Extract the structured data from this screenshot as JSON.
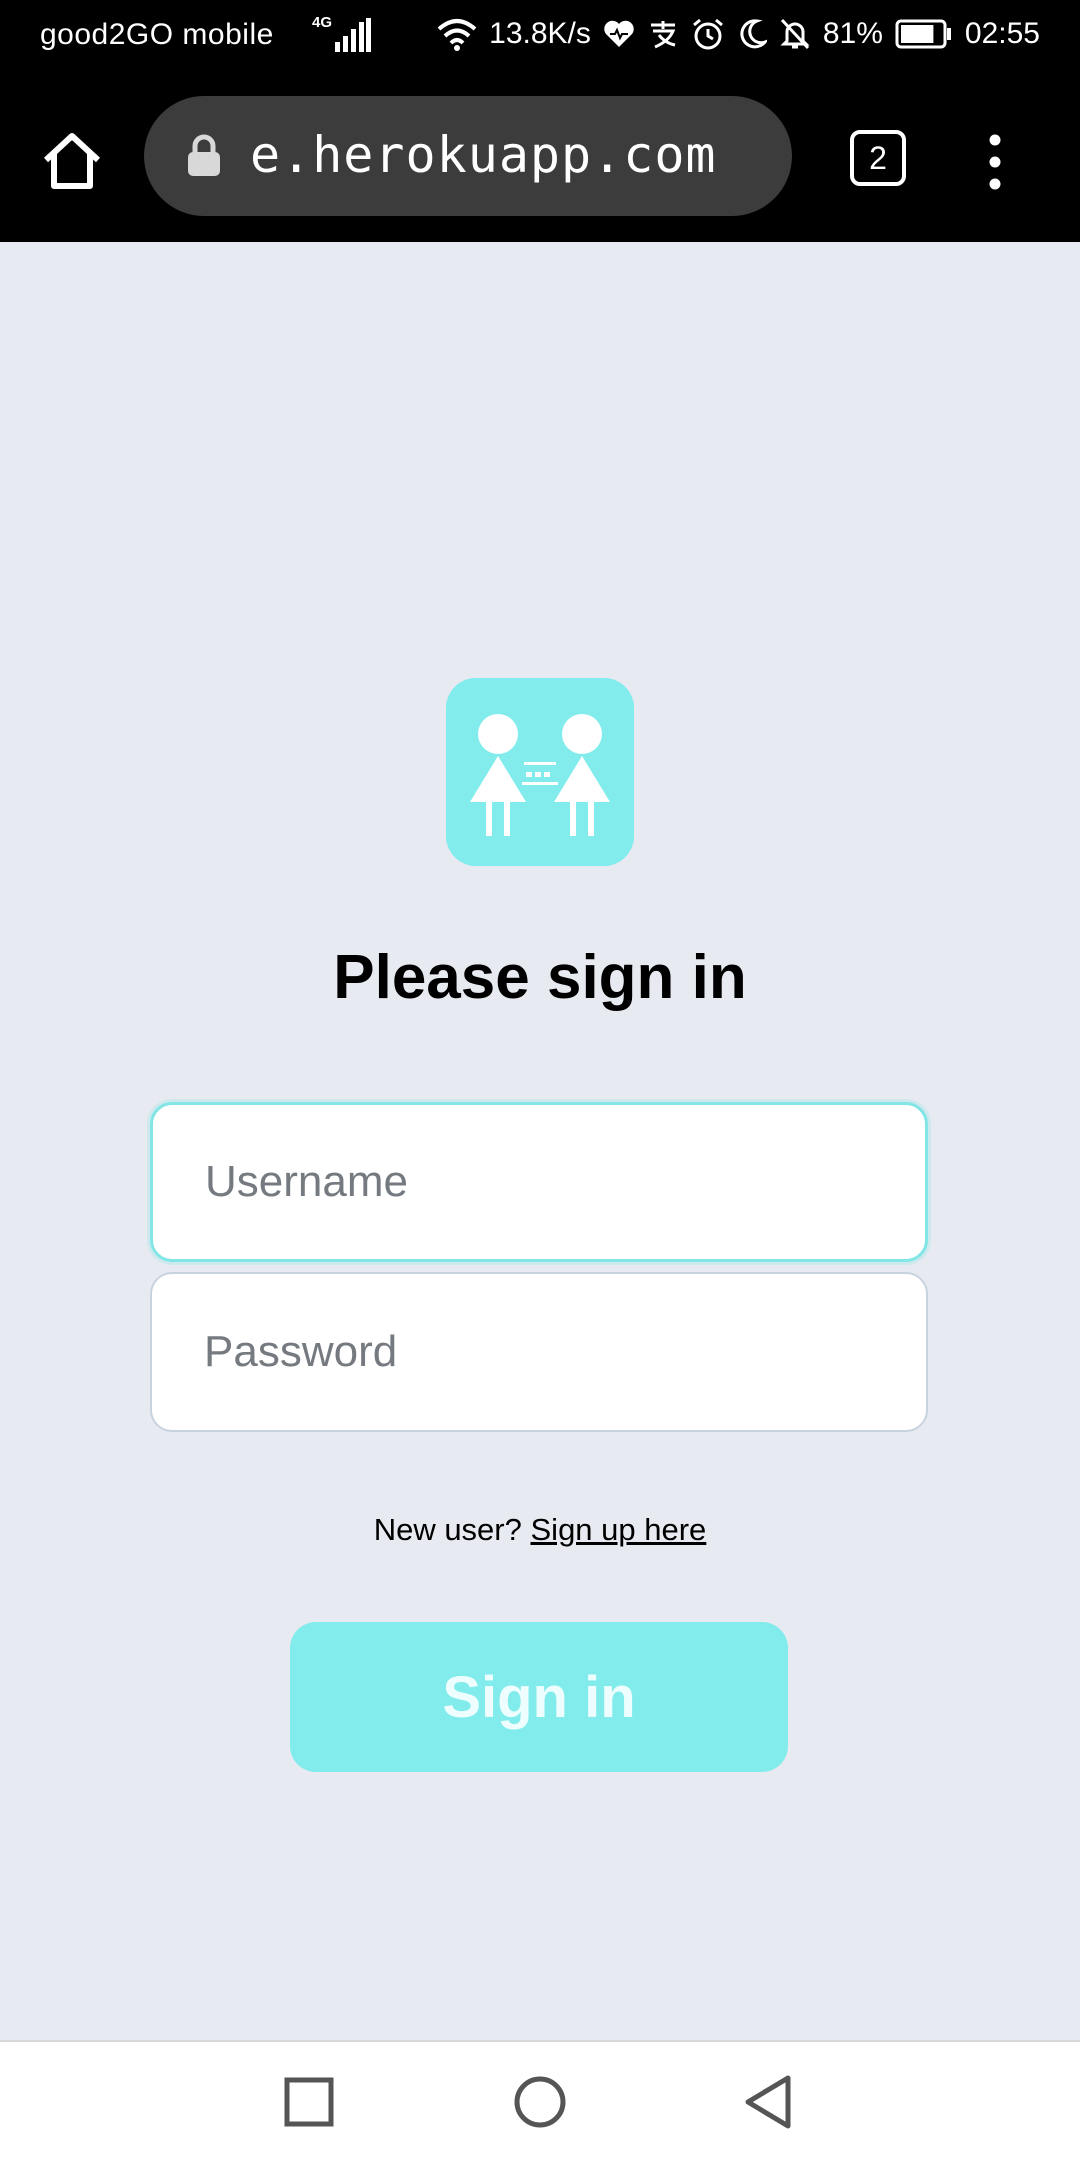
{
  "status_bar": {
    "carrier": "good2GO  mobile",
    "network_generation": "4G",
    "speed": "13.8K/s",
    "battery_percent": "81%",
    "battery_level": 0.81,
    "time": "02:55",
    "icons": [
      "signal-icon",
      "wifi-icon",
      "health-icon",
      "alipay-icon",
      "alarm-icon",
      "do-not-disturb-icon",
      "notifications-off-icon",
      "battery-icon"
    ]
  },
  "browser": {
    "url": "e.herokuapp.com",
    "tab_count": "2"
  },
  "page": {
    "heading": "Please sign in",
    "username_placeholder": "Username",
    "password_placeholder": "Password",
    "new_user_text": "New user?",
    "signup_link": "Sign up here",
    "signin_button": "Sign in"
  },
  "colors": {
    "accent": "#82ecec",
    "background": "#e7eaf0"
  }
}
